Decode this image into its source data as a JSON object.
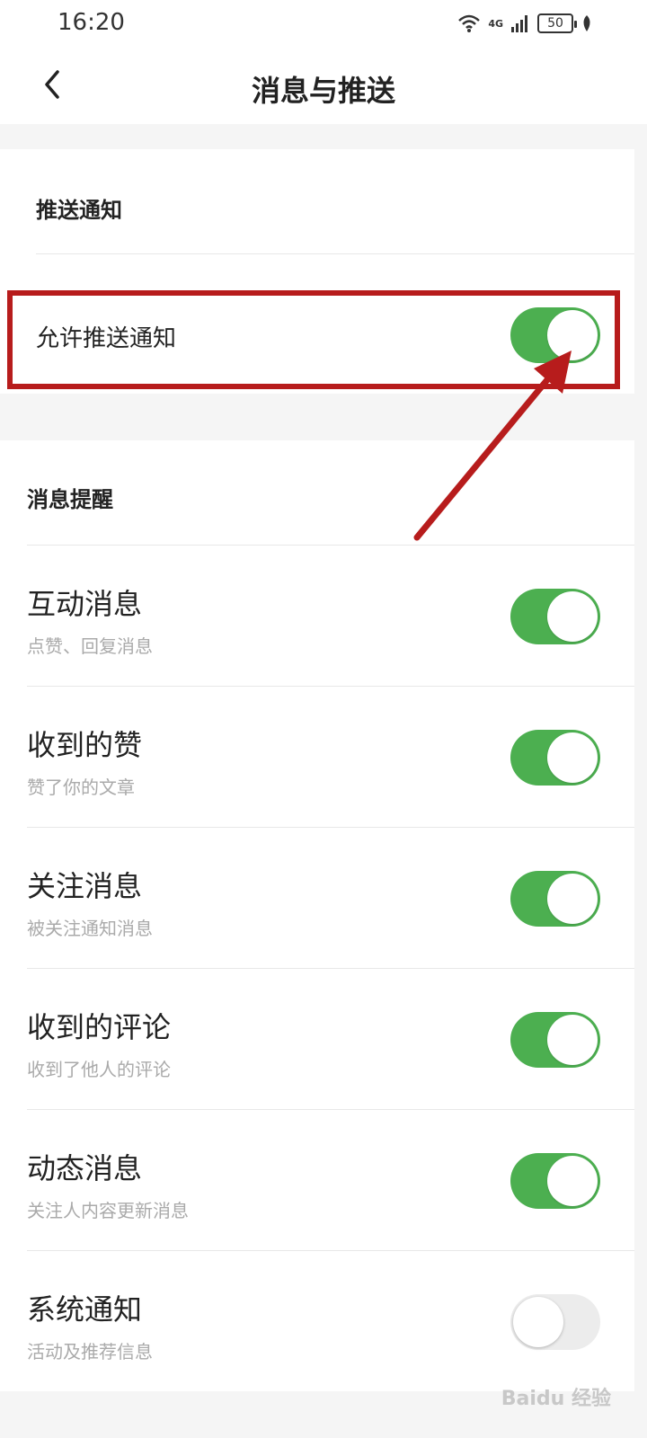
{
  "status_bar": {
    "time": "16:20",
    "network": "4G",
    "battery": "50"
  },
  "nav": {
    "title": "消息与推送"
  },
  "push_section": {
    "title": "推送通知",
    "allow_label": "允许推送通知",
    "allow_on": true
  },
  "message_section": {
    "title": "消息提醒",
    "items": [
      {
        "title": "互动消息",
        "subtitle": "点赞、回复消息",
        "on": true
      },
      {
        "title": "收到的赞",
        "subtitle": "赞了你的文章",
        "on": true
      },
      {
        "title": "关注消息",
        "subtitle": "被关注通知消息",
        "on": true
      },
      {
        "title": "收到的评论",
        "subtitle": "收到了他人的评论",
        "on": true
      },
      {
        "title": "动态消息",
        "subtitle": "关注人内容更新消息",
        "on": true
      },
      {
        "title": "系统通知",
        "subtitle": "活动及推荐信息",
        "on": false
      }
    ]
  },
  "colors": {
    "toggle_on": "#4caf50",
    "toggle_off": "#ececec",
    "highlight": "#b71c1c"
  },
  "watermark": "Baidu 经验"
}
